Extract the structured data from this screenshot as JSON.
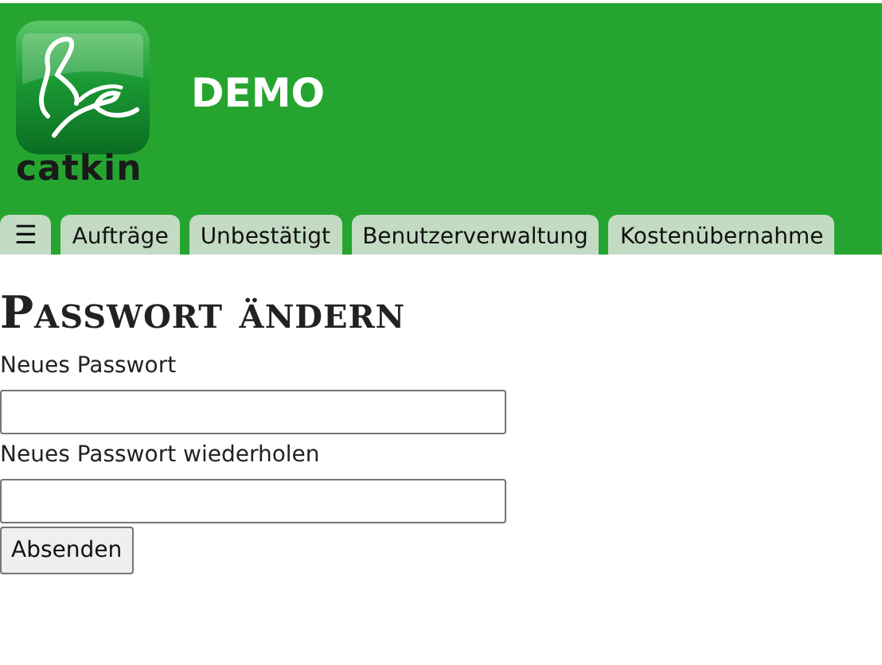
{
  "header": {
    "logo_text": "catkin",
    "title": "DEMO"
  },
  "menu_button": "☰",
  "tabs": [
    {
      "label": "Aufträge"
    },
    {
      "label": "Unbestätigt"
    },
    {
      "label": "Benutzerverwaltung"
    },
    {
      "label": "Kostenübernahme"
    }
  ],
  "form": {
    "heading": "Passwort ändern",
    "fields": [
      {
        "label": "Neues Passwort"
      },
      {
        "label": "Neues Passwort wiederholen"
      }
    ],
    "submit": "Absenden"
  }
}
